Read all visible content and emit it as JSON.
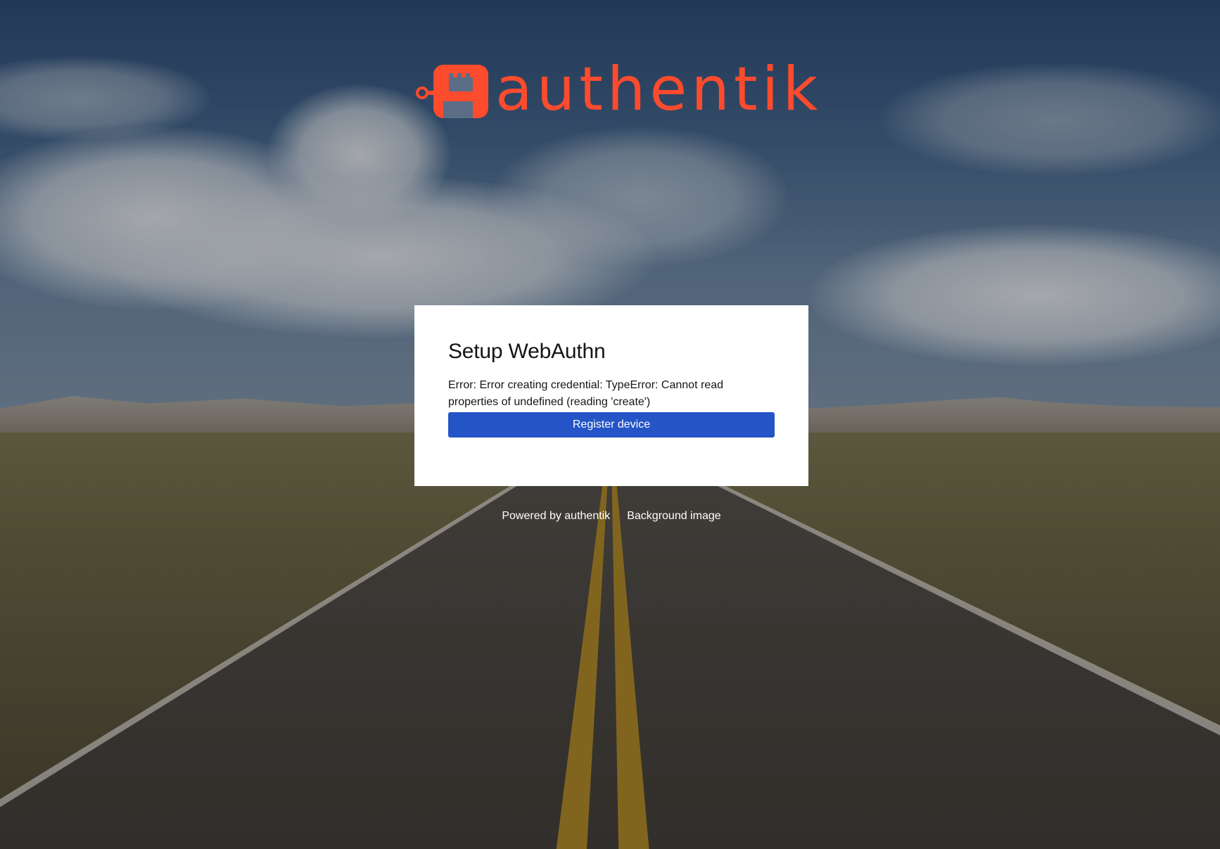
{
  "logo": {
    "text": "authentik",
    "color": "#fd4b2d"
  },
  "card": {
    "title": "Setup WebAuthn",
    "error_message": "Error: Error creating credential: TypeError: Cannot read properties of undefined (reading 'create')",
    "register_button_label": "Register device",
    "button_color": "#2454c6"
  },
  "footer": {
    "links": [
      {
        "label": "Powered by authentik"
      },
      {
        "label": "Background image"
      }
    ]
  }
}
